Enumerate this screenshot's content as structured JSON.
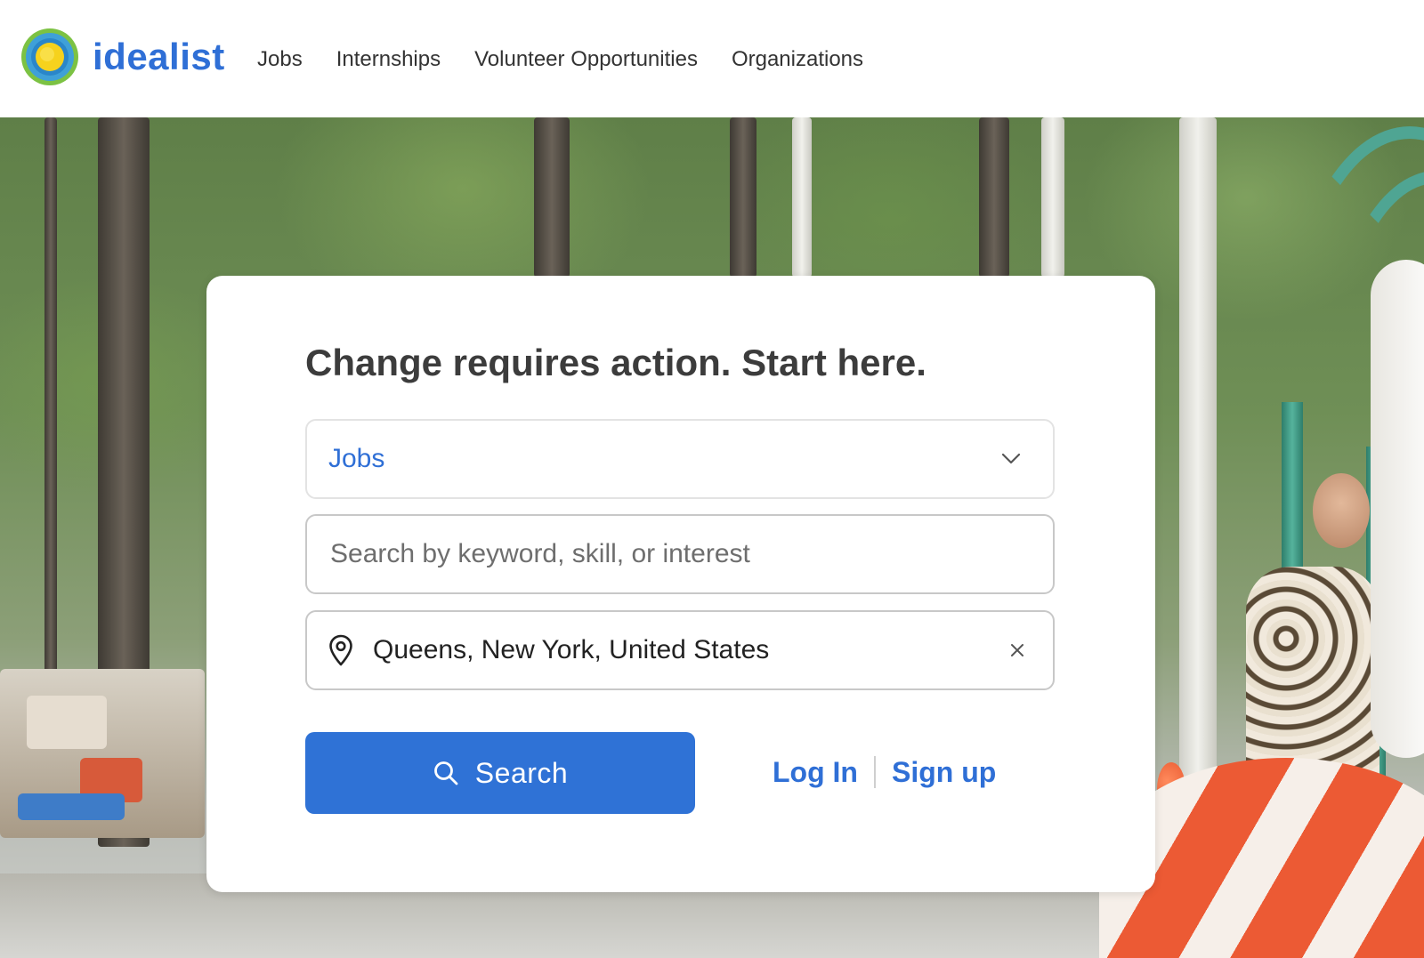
{
  "brand": {
    "name": "idealist",
    "logo_icon": "idealist-sun-logo-icon",
    "accent_color": "#2f6fd6"
  },
  "nav": {
    "items": [
      {
        "label": "Jobs"
      },
      {
        "label": "Internships"
      },
      {
        "label": "Volunteer Opportunities"
      },
      {
        "label": "Organizations"
      }
    ]
  },
  "search_card": {
    "title": "Change requires action. Start here.",
    "type_select": {
      "value": "Jobs",
      "icon": "chevron-down-icon"
    },
    "keyword": {
      "placeholder": "Search by keyword, skill, or interest",
      "value": ""
    },
    "location": {
      "value": "Queens, New York, United States",
      "icon": "location-pin-icon",
      "clear_icon": "close-icon"
    },
    "search_button": {
      "label": "Search",
      "icon": "search-icon",
      "color": "#2f72d6"
    },
    "login_label": "Log In",
    "signup_label": "Sign up"
  }
}
